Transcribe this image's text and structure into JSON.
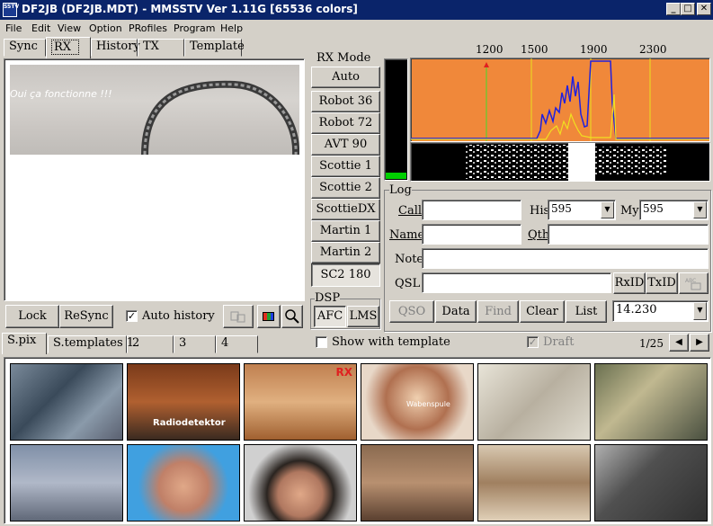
{
  "window": {
    "title": "DF2JB (DF2JB.MDT) - MMSSTV Ver 1.11G [65536 colors]",
    "icon_text": "SSTV"
  },
  "menu": [
    "File",
    "Edit",
    "View",
    "Option",
    "PRofiles",
    "Program",
    "Help"
  ],
  "tabs": [
    "Sync",
    "RX",
    "History",
    "TX",
    "Template"
  ],
  "rx_image": {
    "overlay_text": "Oui ça fonctionne !!!"
  },
  "rx_mode": {
    "title": "RX Mode",
    "modes": [
      "Auto",
      "Robot 36",
      "Robot 72",
      "AVT 90",
      "Scottie 1",
      "Scottie 2",
      "ScottieDX",
      "Martin 1",
      "Martin 2",
      "SC2 180"
    ],
    "selected": "SC2 180"
  },
  "rx_controls": {
    "lock": "Lock",
    "resync": "ReSync",
    "auto_history_label": "Auto history",
    "auto_history_checked": true
  },
  "dsp": {
    "title": "DSP",
    "afc": "AFC",
    "lms": "LMS"
  },
  "spectrum": {
    "freq_labels": [
      "1200",
      "1500",
      "1900",
      "2300"
    ],
    "level": 0.05,
    "bg_color": "#f0883a"
  },
  "log": {
    "title": "Log",
    "call_label": "Call",
    "call_value": "",
    "his_label": "His",
    "his_value": "595",
    "my_label": "My",
    "my_value": "595",
    "name_label": "Name",
    "name_value": "",
    "qth_label": "Qth",
    "qth_value": "",
    "note_label": "Note",
    "note_value": "",
    "qsl_label": "QSL",
    "qsl_value": "",
    "rxid": "RxID",
    "txid": "TxID",
    "buttons": [
      "QSO",
      "Data",
      "Find",
      "Clear",
      "List"
    ],
    "frequency": "14.230"
  },
  "bottom_tabs": [
    "S.pix",
    "S.templates 1",
    "2",
    "3",
    "4"
  ],
  "show_with_template": "Show with template",
  "draft": "Draft",
  "page": "1/25",
  "thumb_captions": [
    "Radiodetektor",
    "Wabenspule",
    "RX"
  ]
}
